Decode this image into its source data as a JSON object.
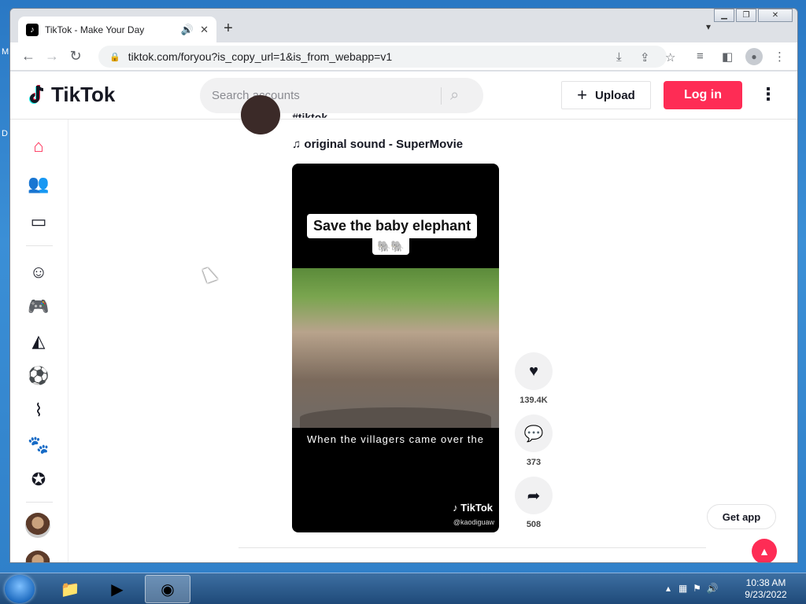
{
  "desktop": {
    "label_m": "M",
    "label_d": "D"
  },
  "browser": {
    "tab_title": "TikTok - Make Your Day",
    "tab_fav": "♪",
    "url": "tiktok.com/foryou?is_copy_url=1&is_from_webapp=v1"
  },
  "header": {
    "logo_text": "TikTok",
    "search_placeholder": "Search accounts",
    "upload_label": "Upload",
    "login_label": "Log in"
  },
  "post": {
    "hashtag": "#tiktok",
    "sound": "original sound - SuperMovie",
    "caption": "Save the baby elephant",
    "caption_emoji": "🐘🐘",
    "subtitle": "When the villagers came over the",
    "watermark": "TikTok",
    "watermark_user": "@kaodiguaw",
    "likes": "139.4K",
    "comments": "373",
    "shares": "508"
  },
  "floating": {
    "get_app": "Get app"
  },
  "taskbar": {
    "time": "10:38 AM",
    "date": "9/23/2022"
  },
  "colors": {
    "brand": "#fe2c55",
    "text": "#161823"
  }
}
